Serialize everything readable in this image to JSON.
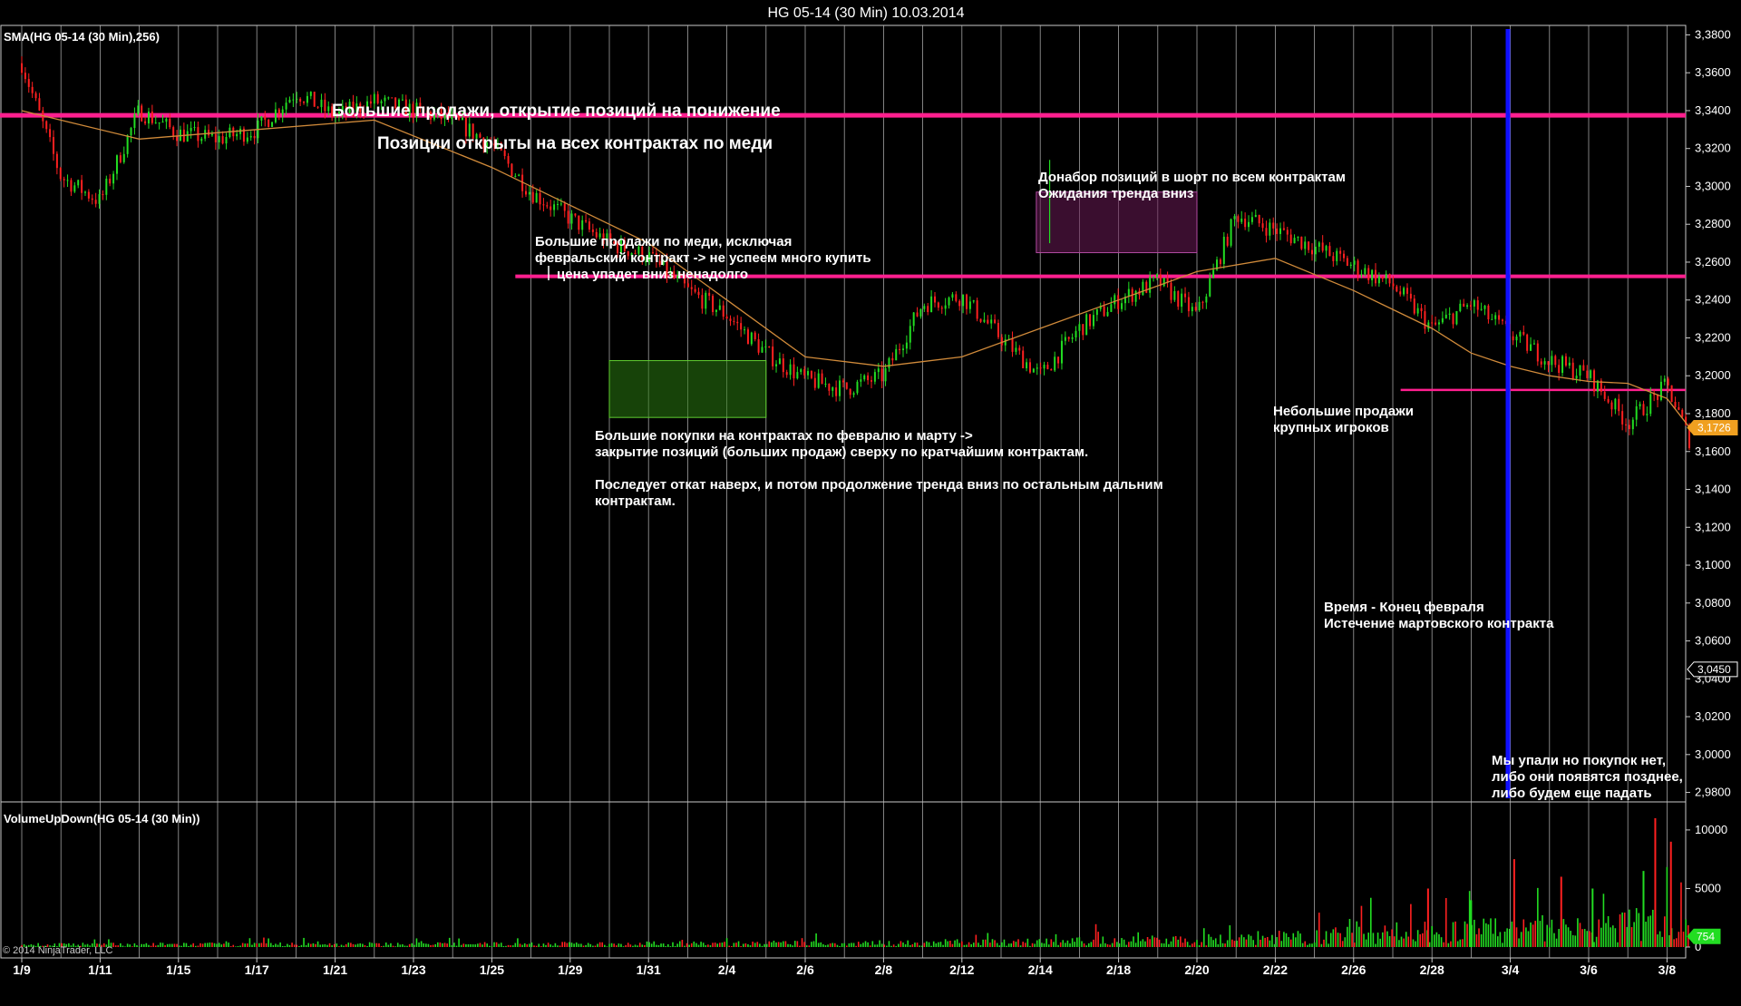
{
  "window": {
    "title": "HG 05-14 (30 Min)  10.03.2014",
    "copyright": "© 2014 NinjaTrader, LLC"
  },
  "colors": {
    "background": "#000000",
    "up": "#22dd22",
    "down": "#ff2020",
    "sma": "#d08a3a",
    "level": "#ff1f8f",
    "expiry": "#1010ff",
    "grid": "#bfbfbf"
  },
  "chart_data": [
    {
      "type": "line",
      "title": "SMA(HG 05-14 (30 Min),256)",
      "indicator": "SMA(HG 05-14 (30 Min),256)",
      "x_ticks": [
        "1/9",
        "1/11",
        "1/15",
        "1/17",
        "1/21",
        "1/23",
        "1/25",
        "1/29",
        "1/31",
        "2/4",
        "2/6",
        "2/8",
        "2/12",
        "2/14",
        "2/18",
        "2/20",
        "2/22",
        "2/26",
        "2/28",
        "3/4",
        "3/6",
        "3/8"
      ],
      "y_ticks": [
        "3,3800",
        "3,3600",
        "3,3400",
        "3,3200",
        "3,3000",
        "3,2800",
        "3,2600",
        "3,2400",
        "3,2200",
        "3,2000",
        "3,1800",
        "3,1600",
        "3,1400",
        "3,1200",
        "3,1000",
        "3,0800",
        "3,0600",
        "3,0400",
        "3,0200",
        "3,0000",
        "2,9800"
      ],
      "ylim": [
        2.975,
        3.385
      ],
      "price_tags": [
        {
          "label": "3,1726",
          "value": 3.1726,
          "color": "#f0a020"
        },
        {
          "label": "3,0450",
          "value": 3.045,
          "color": "#000000"
        }
      ],
      "series": [
        {
          "x": [
            0,
            0.5,
            1,
            1.5,
            2,
            2.5,
            3,
            3.5,
            4,
            4.5,
            5,
            5.5,
            6,
            6.5,
            7,
            7.5,
            8,
            8.5,
            9,
            9.5,
            10,
            10.5,
            11,
            11.5,
            12,
            12.5,
            13,
            13.5,
            14,
            14.5,
            15,
            15.5,
            16,
            16.5,
            17,
            17.5,
            18,
            18.5,
            19,
            19.5,
            20,
            20.5,
            21,
            21.3
          ],
          "values": [
            3.365,
            3.305,
            3.292,
            3.34,
            3.328,
            3.325,
            3.33,
            3.35,
            3.337,
            3.345,
            3.34,
            3.335,
            3.322,
            3.297,
            3.283,
            3.27,
            3.263,
            3.245,
            3.232,
            3.212,
            3.198,
            3.193,
            3.2,
            3.238,
            3.242,
            3.22,
            3.2,
            3.225,
            3.24,
            3.25,
            3.232,
            3.285,
            3.277,
            3.268,
            3.258,
            3.248,
            3.225,
            3.238,
            3.222,
            3.208,
            3.2,
            3.175,
            3.195,
            3.165
          ]
        },
        {
          "x": [
            0,
            1.5,
            3,
            4.5,
            6,
            7,
            8,
            9,
            10,
            11,
            12,
            13,
            14,
            15,
            16,
            17,
            18,
            18.5,
            19,
            19.5,
            20,
            20.5,
            21,
            21.3
          ],
          "values": [
            3.34,
            3.325,
            3.33,
            3.335,
            3.31,
            3.29,
            3.27,
            3.24,
            3.21,
            3.205,
            3.21,
            3.225,
            3.24,
            3.255,
            3.262,
            3.245,
            3.225,
            3.212,
            3.205,
            3.2,
            3.197,
            3.196,
            3.188,
            3.172
          ]
        }
      ],
      "levels": [
        3.3375,
        3.2525,
        3.1925
      ],
      "zones": [
        {
          "x0": 7.5,
          "x1": 9.5,
          "y0": 3.178,
          "y1": 3.208
        },
        {
          "x0": 12.95,
          "x1": 15.0,
          "y0": 3.265,
          "y1": 3.297
        }
      ],
      "annotations": [
        {
          "text": "Большие продажи, открытие позиций на понижение"
        },
        {
          "text": "Позиции открыты на всех контрактах по меди"
        },
        {
          "text": "Донабор позиций в шорт по всем контрактам"
        },
        {
          "text": "Ожидания тренда вниз"
        },
        {
          "text": "Большие продажи по меди, исключая"
        },
        {
          "text": "февральский контракт -> не успеем много купить"
        },
        {
          "text": "цена упадет вниз ненадолго"
        },
        {
          "text": "Большие покупки на контрактах по февралю и марту ->"
        },
        {
          "text": "закрытие позиций (больших продаж) сверху по кратчайшим контрактам."
        },
        {
          "text": "Последует откат наверх, и потом продолжение тренда вниз по остальным дальним"
        },
        {
          "text": "контрактам."
        },
        {
          "text": "Небольшие продажи"
        },
        {
          "text": "крупных игроков"
        },
        {
          "text": "Время - Конец февраля"
        },
        {
          "text": "Истечение мартовского контракта"
        },
        {
          "text": "Мы упали но покупок нет,"
        },
        {
          "text": "либо они появятся позднее,"
        },
        {
          "text": "либо будем еще падать"
        }
      ]
    },
    {
      "type": "bar",
      "title": "VolumeUpDown(HG 05-14 (30 Min))",
      "indicator": "VolumeUpDown(HG 05-14 (30 Min))",
      "y_ticks": [
        "10000",
        "5000",
        "0"
      ],
      "ylim": [
        0,
        11000
      ],
      "last_value": {
        "label": "754",
        "value": 754
      },
      "volume_profile": [
        {
          "x": 0,
          "avg": 200
        },
        {
          "x": 7,
          "avg": 250
        },
        {
          "x": 12,
          "avg": 350
        },
        {
          "x": 15.5,
          "avg": 650
        },
        {
          "x": 18,
          "avg": 1300
        },
        {
          "x": 20,
          "avg": 1500
        },
        {
          "x": 21.3,
          "avg": 2200
        }
      ],
      "spikes": [
        {
          "x": 17.95,
          "value": 5000
        },
        {
          "x": 18.5,
          "value": 4000
        },
        {
          "x": 19.05,
          "value": 7500
        },
        {
          "x": 19.65,
          "value": 6000
        },
        {
          "x": 20.05,
          "value": 5000
        },
        {
          "x": 20.85,
          "value": 11000
        },
        {
          "x": 21.05,
          "value": 9000
        },
        {
          "x": 20.7,
          "value": 6500
        }
      ]
    }
  ]
}
